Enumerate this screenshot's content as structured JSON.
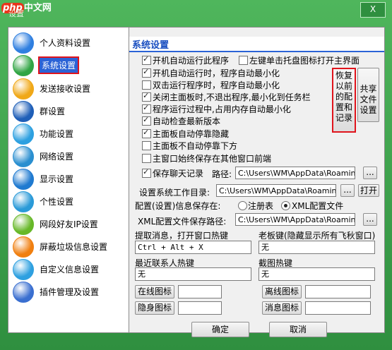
{
  "window": {
    "logo_badge": "php",
    "logo_text": "中文网",
    "title": "设置",
    "close_label": "X"
  },
  "sidebar": {
    "items": [
      {
        "label": "个人资料设置",
        "icon": "globe-icon",
        "color": "#2f7fe0"
      },
      {
        "label": "系统设置",
        "icon": "gear-icon",
        "color": "#31a544",
        "selected": true
      },
      {
        "label": "发送接收设置",
        "icon": "envelope-icon",
        "color": "#f0a818"
      },
      {
        "label": "群设置",
        "icon": "group-icon",
        "color": "#1f5fb8"
      },
      {
        "label": "功能设置",
        "icon": "function-icon",
        "color": "#2da0e0"
      },
      {
        "label": "网络设置",
        "icon": "network-icon",
        "color": "#2a8fd0"
      },
      {
        "label": "显示设置",
        "icon": "monitor-icon",
        "color": "#1f7ad0"
      },
      {
        "label": "个性设置",
        "icon": "puzzle-icon",
        "color": "#2a9ad8"
      },
      {
        "label": "网段好友IP设置",
        "icon": "ip-icon",
        "color": "#67b828"
      },
      {
        "label": "屏蔽垃圾信息设置",
        "icon": "shield-icon",
        "color": "#f07f10"
      },
      {
        "label": "自定义信息设置",
        "icon": "info-icon",
        "color": "#2ea0e0"
      },
      {
        "label": "插件管理及设置",
        "icon": "plugin-icon",
        "color": "#3a6fd0"
      }
    ]
  },
  "main": {
    "section_title": "系统设置",
    "checkboxes": [
      {
        "label": "开机自动运行此程序",
        "checked": true
      },
      {
        "label": "左键单击托盘图标打开主界面",
        "checked": false
      },
      {
        "label": "开机自动运行时，程序自动最小化",
        "checked": true
      },
      {
        "label": "双击运行程序时，程序自动最小化",
        "checked": false
      },
      {
        "label": "关闭主面板时,不退出程序,最小化到任务栏",
        "checked": true
      },
      {
        "label": "程序运行过程中,占用内存自动最小化",
        "checked": true
      },
      {
        "label": "自动检查最新版本",
        "checked": true
      },
      {
        "label": "主面板自动停靠隐藏",
        "checked": true
      },
      {
        "label": "主面板不自动停靠下方",
        "checked": false
      },
      {
        "label": "主窗口始终保存在其他窗口前端",
        "checked": false
      },
      {
        "label": "保存聊天记录",
        "checked": true
      }
    ],
    "restore_button": [
      "恢复",
      "以前",
      "的配",
      "置和",
      "记录"
    ],
    "share_button": [
      "共享",
      "文件",
      "设置"
    ],
    "path_label": "路径:",
    "path_value": "C:\\Users\\WM\\AppData\\Roaming",
    "browse_label": "...",
    "workdir_label": "设置系统工作目录:",
    "workdir_value": "C:\\Users\\WM\\AppData\\Roaming",
    "open_label": "打开",
    "config_label": "配置(设置)信息保存在:",
    "radio_registry": "注册表",
    "radio_xml": "XML配置文件",
    "xml_label": "XML配置文件保存路径:",
    "xml_value": "C:\\Users\\WM\\AppData\\Roaming",
    "hotkey_open_label": "提取消息，打开窗口热键",
    "hotkey_open_value": "Ctrl + Alt + X",
    "hotkey_boss_label": "老板键(隐藏显示所有飞秋窗口)",
    "hotkey_boss_value": "无",
    "hotkey_recent_label": "最近联系人热键",
    "hotkey_recent_value": "无",
    "hotkey_screenshot_label": "截图热键",
    "hotkey_screenshot_value": "无",
    "online_icon": "在线图标",
    "offline_icon": "离线图标",
    "stealth_icon": "隐身图标",
    "message_icon": "消息图标"
  },
  "footer": {
    "ok": "确定",
    "cancel": "取消"
  }
}
